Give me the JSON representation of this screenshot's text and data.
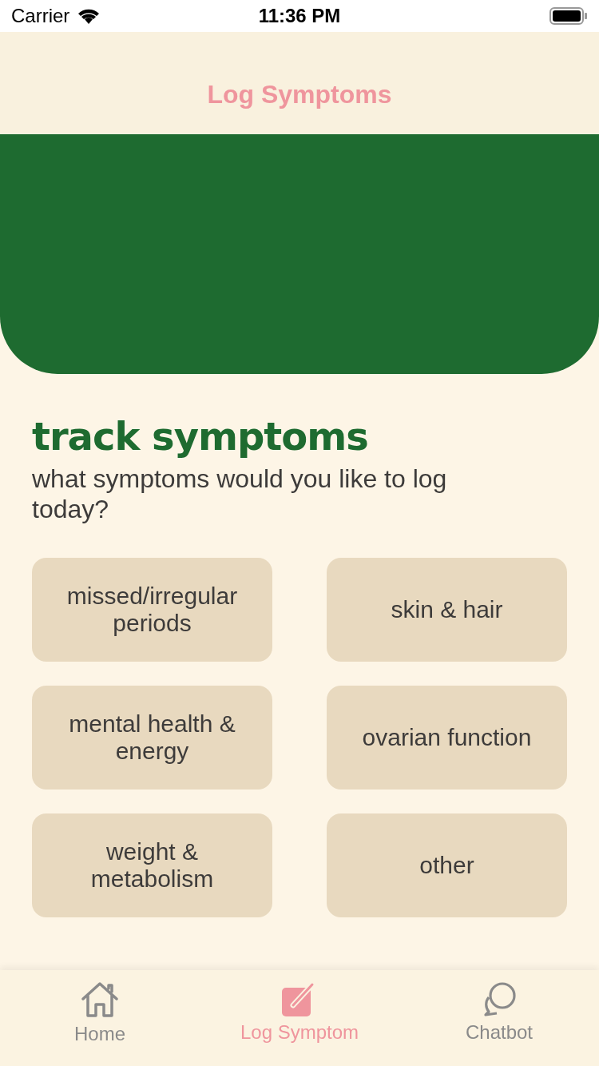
{
  "status_bar": {
    "carrier": "Carrier",
    "time": "11:36 PM"
  },
  "nav": {
    "title": "Log Symptoms"
  },
  "heading": "track symptoms",
  "prompt": "what symptoms would you like to log today?",
  "options": [
    {
      "label": "missed/irregular periods"
    },
    {
      "label": "skin & hair"
    },
    {
      "label": "mental health & energy"
    },
    {
      "label": "ovarian function"
    },
    {
      "label": "weight & metabolism"
    },
    {
      "label": "other"
    }
  ],
  "tabs": [
    {
      "kind": "home",
      "label": "Home",
      "selected": false
    },
    {
      "kind": "log",
      "label": "Log Symptom",
      "selected": true
    },
    {
      "kind": "chat",
      "label": "Chatbot",
      "selected": false
    }
  ]
}
